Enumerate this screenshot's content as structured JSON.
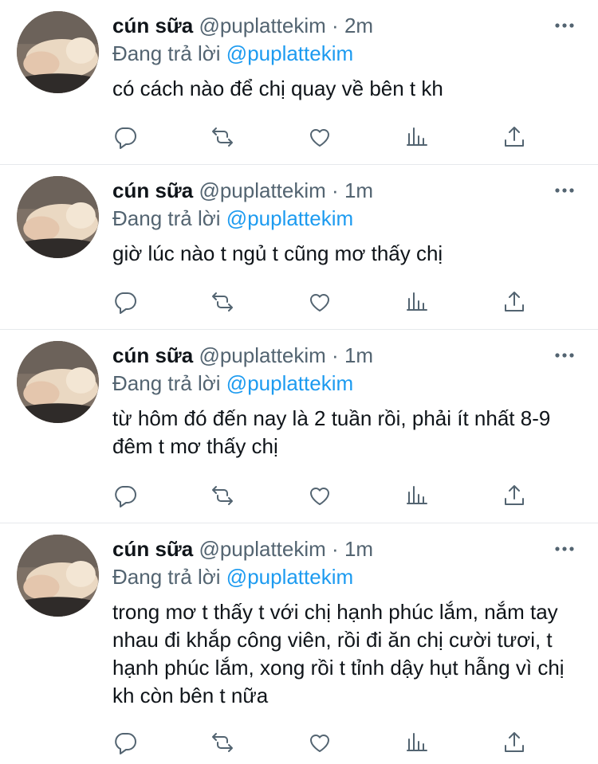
{
  "tweets": [
    {
      "name": "cún sữa",
      "handle": "@puplattekim",
      "separator": "·",
      "time": "2m",
      "reply_prefix": "Đang trả lời",
      "reply_to": "@puplattekim",
      "text": "có cách nào để chị quay về bên t kh"
    },
    {
      "name": "cún sữa",
      "handle": "@puplattekim",
      "separator": "·",
      "time": "1m",
      "reply_prefix": "Đang trả lời",
      "reply_to": "@puplattekim",
      "text": "giờ lúc nào t ngủ t cũng mơ thấy chị"
    },
    {
      "name": "cún sữa",
      "handle": "@puplattekim",
      "separator": "·",
      "time": "1m",
      "reply_prefix": "Đang trả lời",
      "reply_to": "@puplattekim",
      "text": "từ hôm đó đến nay là 2 tuần rồi, phải ít nhất 8-9 đêm t mơ thấy chị"
    },
    {
      "name": "cún sữa",
      "handle": "@puplattekim",
      "separator": "·",
      "time": "1m",
      "reply_prefix": "Đang trả lời",
      "reply_to": "@puplattekim",
      "text": "trong mơ t thấy t với chị hạnh phúc lắm, nắm tay nhau đi khắp công viên, rồi đi ăn chị cười tươi, t hạnh phúc lắm, xong rồi t tỉnh dậy hụt hẫng vì chị kh còn bên t nữa"
    }
  ],
  "icons": {
    "more": "more-horizontal-icon",
    "reply": "reply-bubble-icon",
    "retweet": "retweet-icon",
    "like": "heart-icon",
    "views": "views-bar-chart-icon",
    "share": "share-upload-icon"
  },
  "colors": {
    "text": "#0f1419",
    "secondary": "#536471",
    "mention": "#1d9bf0",
    "divider": "#e6e9ec"
  }
}
